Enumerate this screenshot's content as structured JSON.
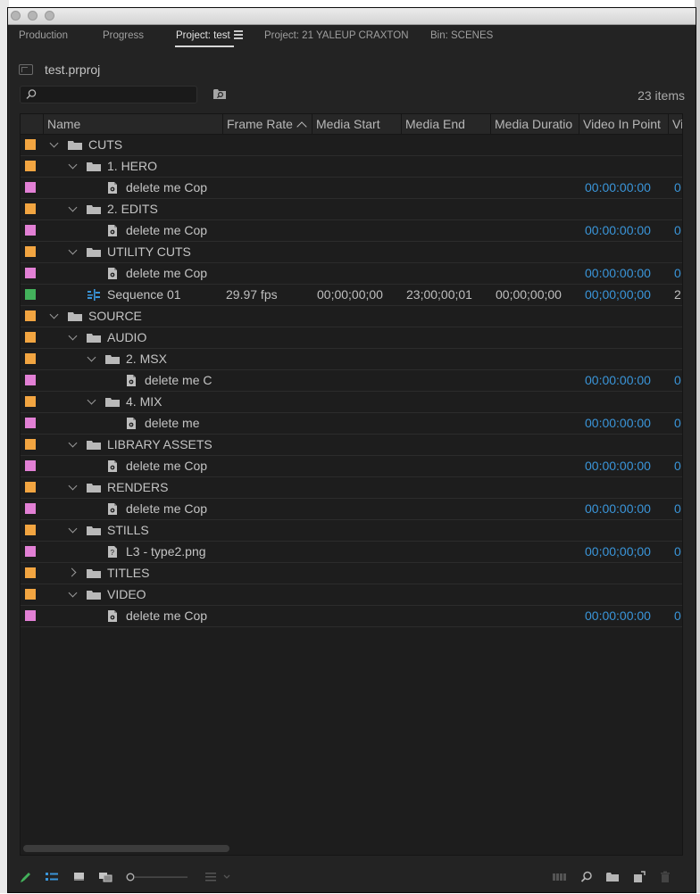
{
  "tabs": [
    {
      "label": "Production"
    },
    {
      "label": "Progress"
    },
    {
      "label": "Project: test"
    },
    {
      "label": "Project: 21 YALEUP CRAXTON"
    },
    {
      "label": "Bin: SCENES"
    }
  ],
  "project": {
    "name": "test.prproj",
    "items_count": "23 items"
  },
  "search": {
    "placeholder": "",
    "value": ""
  },
  "columns": [
    {
      "label": "Name"
    },
    {
      "label": "Frame Rate",
      "sorted": "ascending"
    },
    {
      "label": "Media Start"
    },
    {
      "label": "Media End"
    },
    {
      "label": "Media Duratio"
    },
    {
      "label": "Video In Point"
    },
    {
      "label": "Vi"
    }
  ],
  "colors": {
    "orange": "#f2a541",
    "magenta": "#e280d5",
    "green": "#43b15b",
    "timecode_blue": "#3a95d9"
  },
  "rows": [
    {
      "label_color": "orange",
      "depth": 0,
      "twirl": "open",
      "icon": "folder-icon",
      "name": "CUTS"
    },
    {
      "label_color": "orange",
      "depth": 1,
      "twirl": "open",
      "icon": "folder-icon",
      "name": "1. HERO"
    },
    {
      "label_color": "magenta",
      "depth": 2,
      "icon": "media-file-icon",
      "name": "delete me Cop",
      "video_in": "00:00:00:00",
      "vi": "0"
    },
    {
      "label_color": "orange",
      "depth": 1,
      "twirl": "open",
      "icon": "folder-icon",
      "name": "2. EDITS"
    },
    {
      "label_color": "magenta",
      "depth": 2,
      "icon": "media-file-icon",
      "name": "delete me Cop",
      "video_in": "00:00:00:00",
      "vi": "0"
    },
    {
      "label_color": "orange",
      "depth": 1,
      "twirl": "open",
      "icon": "folder-icon",
      "name": "UTILITY CUTS"
    },
    {
      "label_color": "magenta",
      "depth": 2,
      "icon": "media-file-icon",
      "name": "delete me Cop",
      "video_in": "00:00:00:00",
      "vi": "0"
    },
    {
      "label_color": "green",
      "depth": 2,
      "icon": "sequence-icon",
      "icon_offset": -1,
      "name": "Sequence 01",
      "frame_rate": "29.97 fps",
      "media_start": "00;00;00;00",
      "media_end": "23;00;00;01",
      "media_duration": "00;00;00;00",
      "video_in": "00;00;00;00",
      "vi": "2"
    },
    {
      "label_color": "orange",
      "depth": 0,
      "twirl": "open",
      "icon": "folder-icon",
      "name": "SOURCE"
    },
    {
      "label_color": "orange",
      "depth": 1,
      "twirl": "open",
      "icon": "folder-icon",
      "name": "AUDIO"
    },
    {
      "label_color": "orange",
      "depth": 2,
      "twirl": "open",
      "icon": "folder-icon",
      "name": "2. MSX"
    },
    {
      "label_color": "magenta",
      "depth": 3,
      "icon": "media-file-icon",
      "name": "delete me C",
      "video_in": "00:00:00:00",
      "vi": "0"
    },
    {
      "label_color": "orange",
      "depth": 2,
      "twirl": "open",
      "icon": "folder-icon",
      "name": "4. MIX"
    },
    {
      "label_color": "magenta",
      "depth": 3,
      "icon": "media-file-icon",
      "name": "delete me",
      "video_in": "00:00:00:00",
      "vi": "0"
    },
    {
      "label_color": "orange",
      "depth": 1,
      "twirl": "open",
      "icon": "folder-icon",
      "name": "LIBRARY ASSETS"
    },
    {
      "label_color": "magenta",
      "depth": 2,
      "icon": "media-file-icon",
      "name": "delete me Cop",
      "video_in": "00:00:00:00",
      "vi": "0"
    },
    {
      "label_color": "orange",
      "depth": 1,
      "twirl": "open",
      "icon": "folder-icon",
      "name": "RENDERS"
    },
    {
      "label_color": "magenta",
      "depth": 2,
      "icon": "media-file-icon",
      "name": "delete me Cop",
      "video_in": "00:00:00:00",
      "vi": "0"
    },
    {
      "label_color": "orange",
      "depth": 1,
      "twirl": "open",
      "icon": "folder-icon",
      "name": "STILLS"
    },
    {
      "label_color": "magenta",
      "depth": 2,
      "icon": "still-image-icon",
      "name": "L3 - type2.png",
      "video_in": "00;00;00;00",
      "vi": "0"
    },
    {
      "label_color": "orange",
      "depth": 1,
      "twirl": "closed",
      "icon": "folder-icon",
      "name": "TITLES"
    },
    {
      "label_color": "orange",
      "depth": 1,
      "twirl": "open",
      "icon": "folder-icon",
      "name": "VIDEO"
    },
    {
      "label_color": "magenta",
      "depth": 2,
      "icon": "media-file-icon",
      "name": "delete me Cop",
      "video_in": "00:00:00:00",
      "vi": "0"
    }
  ],
  "bottom_toolbar": {
    "left": [
      "pencil-icon",
      "list-view-icon",
      "icon-view-icon",
      "freeform-view-icon",
      "zoom-slider",
      "sort-icons-icon"
    ],
    "right": [
      "automate-to-sequence-icon",
      "find-icon",
      "new-bin-icon",
      "new-item-icon",
      "clear-icon"
    ]
  }
}
